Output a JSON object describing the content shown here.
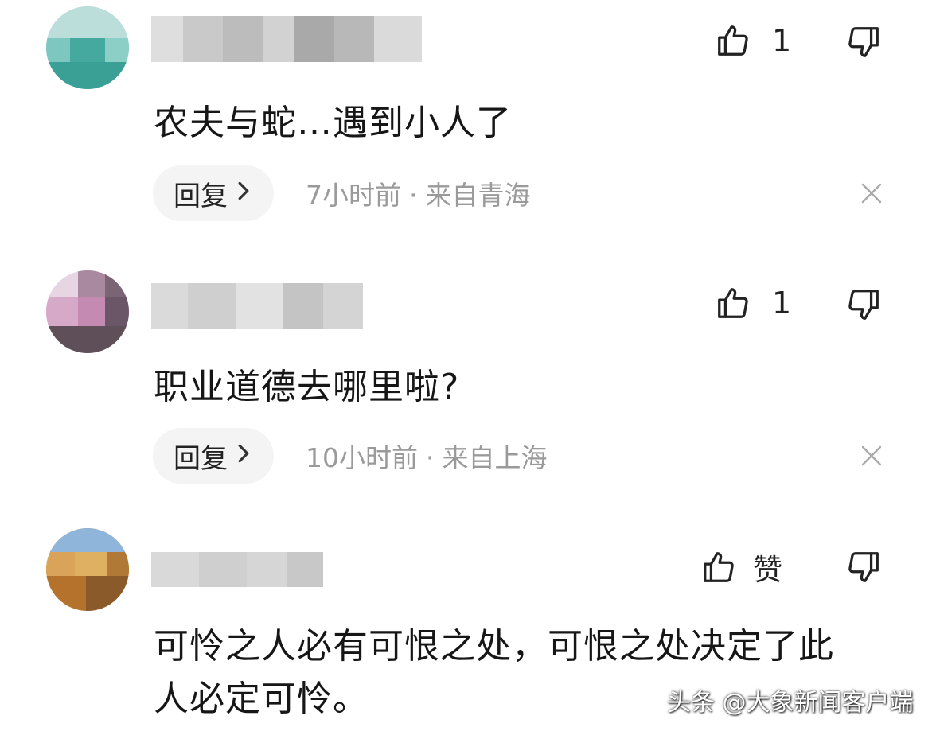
{
  "comments": [
    {
      "likes": "1",
      "text": "农夫与蛇…遇到小人了",
      "reply_label": "回复",
      "time": "7小时前",
      "location": "来自青海"
    },
    {
      "likes": "1",
      "text": "职业道德去哪里啦?",
      "reply_label": "回复",
      "time": "10小时前",
      "location": "来自上海"
    },
    {
      "likes": "赞",
      "text_line1": "可怜之人必有可恨之处，可恨之处决定了此",
      "text_line2": "人必定可怜。"
    }
  ],
  "separator": "·",
  "watermark": "头条 @大象新闻客户端",
  "icons": {
    "like": "thumbs-up-icon",
    "dislike": "thumbs-down-icon",
    "close": "close-icon",
    "reply_chevron": "chevron-right-icon"
  }
}
